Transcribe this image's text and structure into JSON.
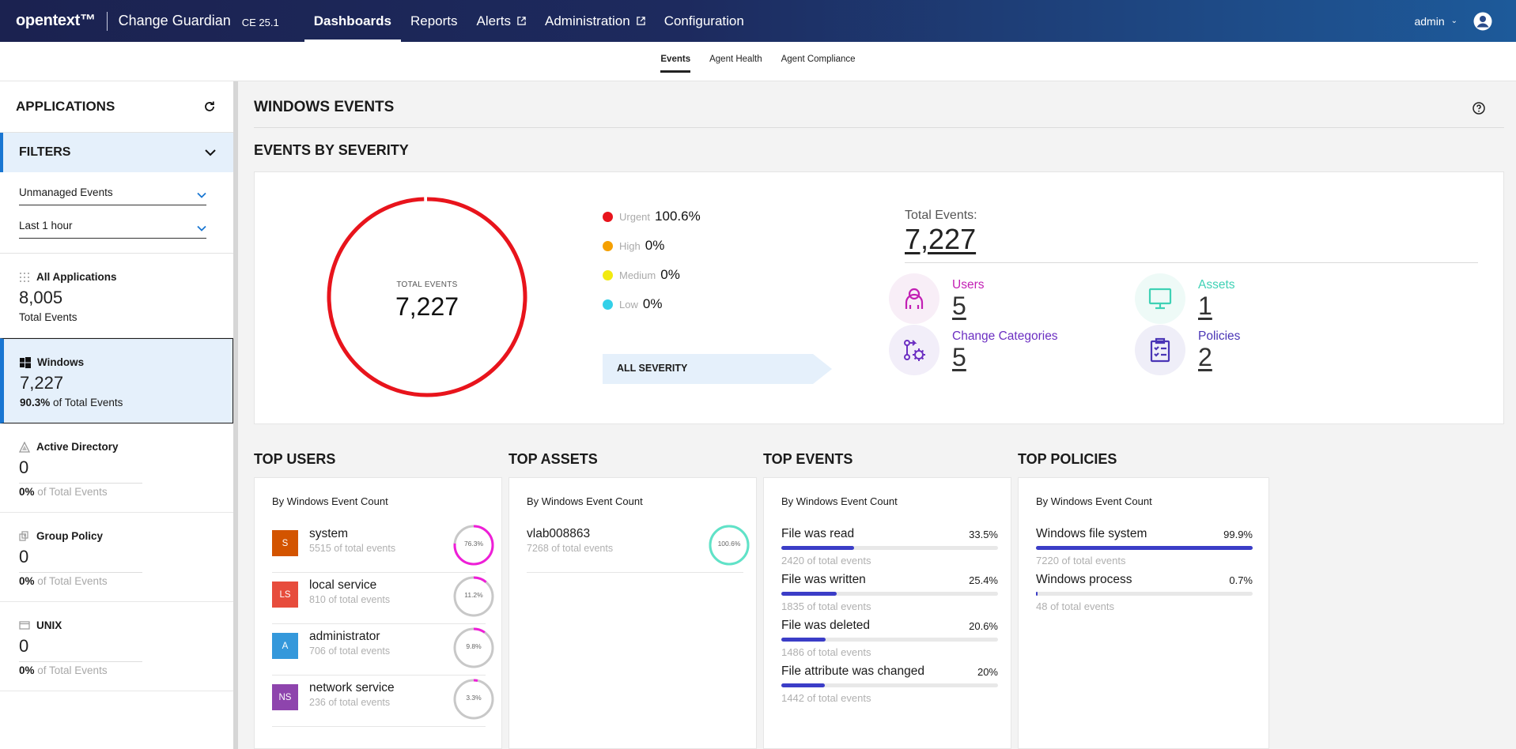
{
  "topbar": {
    "brand": "opentext™",
    "product": "Change Guardian",
    "version": "CE 25.1",
    "nav": [
      {
        "label": "Dashboards",
        "active": true,
        "external": false
      },
      {
        "label": "Reports",
        "active": false,
        "external": false
      },
      {
        "label": "Alerts",
        "active": false,
        "external": true
      },
      {
        "label": "Administration",
        "active": false,
        "external": true
      },
      {
        "label": "Configuration",
        "active": false,
        "external": false
      }
    ],
    "user": "admin",
    "icons": {
      "external": "external-link-icon",
      "caret": "chevron-down-icon",
      "avatar": "user-avatar-icon"
    }
  },
  "subtabs": [
    {
      "label": "Events",
      "active": true
    },
    {
      "label": "Agent Health",
      "active": false
    },
    {
      "label": "Agent Compliance",
      "active": false
    }
  ],
  "sidebar": {
    "title": "APPLICATIONS",
    "filters_title": "FILTERS",
    "filter_event_type": "Unmanaged Events",
    "filter_time": "Last 1 hour",
    "items": [
      {
        "name": "All Applications",
        "count": "8,005",
        "sub_pct": "",
        "sub_text": "Total Events",
        "icon": "grid-dots-icon",
        "selected": false
      },
      {
        "name": "Windows",
        "count": "7,227",
        "sub_pct": "90.3%",
        "sub_text": " of Total Events",
        "icon": "windows-logo-icon",
        "selected": true
      },
      {
        "name": "Active Directory",
        "count": "0",
        "sub_pct": "0%",
        "sub_text": " of Total Events",
        "icon": "active-directory-icon",
        "selected": false
      },
      {
        "name": "Group Policy",
        "count": "0",
        "sub_pct": "0%",
        "sub_text": " of Total Events",
        "icon": "group-policy-icon",
        "selected": false
      },
      {
        "name": "UNIX",
        "count": "0",
        "sub_pct": "0%",
        "sub_text": " of Total Events",
        "icon": "unix-terminal-icon",
        "selected": false
      }
    ]
  },
  "main": {
    "title": "WINDOWS EVENTS",
    "severity_title": "EVENTS BY SEVERITY",
    "donut_label": "TOTAL EVENTS",
    "donut_value": "7,227",
    "donut_color": "#e8141c",
    "legend": [
      {
        "name": "Urgent",
        "pct": "100.6%",
        "color": "#e8141c"
      },
      {
        "name": "High",
        "pct": "0%",
        "color": "#f5a000"
      },
      {
        "name": "Medium",
        "pct": "0%",
        "color": "#f2ea10"
      },
      {
        "name": "Low",
        "pct": "0%",
        "color": "#33d0e8"
      }
    ],
    "all_severity": "ALL SEVERITY",
    "total_label": "Total Events:",
    "total_value": "7,227",
    "stats": [
      {
        "name": "Users",
        "value": "5",
        "color": "#c21fb4",
        "icon": "users-icon"
      },
      {
        "name": "Assets",
        "value": "1",
        "color": "#3fd1b5",
        "icon": "monitor-icon"
      },
      {
        "name": "Change Categories",
        "value": "5",
        "color": "#6c2fc2",
        "icon": "change-categories-icon"
      },
      {
        "name": "Policies",
        "value": "2",
        "color": "#4a35b6",
        "icon": "policy-clipboard-icon"
      }
    ],
    "help_icon": "help-circle-icon"
  },
  "top_users": {
    "title": "TOP USERS",
    "subtitle": "By Windows Event Count",
    "rows": [
      {
        "initials": "S",
        "name": "system",
        "sub": "5515 of total events",
        "pct": "76.3%",
        "fraction": 0.763,
        "badge": "#d35400",
        "ring": "#ef1ed8"
      },
      {
        "initials": "LS",
        "name": "local service",
        "sub": "810 of total events",
        "pct": "11.2%",
        "fraction": 0.112,
        "badge": "#e74c3c",
        "ring": "#ef1ed8"
      },
      {
        "initials": "A",
        "name": "administrator",
        "sub": "706 of total events",
        "pct": "9.8%",
        "fraction": 0.098,
        "badge": "#3498db",
        "ring": "#ef1ed8"
      },
      {
        "initials": "NS",
        "name": "network service",
        "sub": "236 of total events",
        "pct": "3.3%",
        "fraction": 0.033,
        "badge": "#8e44ad",
        "ring": "#ef1ed8"
      }
    ]
  },
  "top_assets": {
    "title": "TOP ASSETS",
    "subtitle": "By Windows Event Count",
    "rows": [
      {
        "name": "vlab008863",
        "sub": "7268 of total events",
        "pct": "100.6%",
        "fraction": 1.0,
        "ring": "#5fe3c8"
      }
    ]
  },
  "top_events": {
    "title": "TOP EVENTS",
    "subtitle": "By Windows Event Count",
    "rows": [
      {
        "name": "File was read",
        "pct": "33.5%",
        "fraction": 0.335,
        "sub": "2420 of total events"
      },
      {
        "name": "File was written",
        "pct": "25.4%",
        "fraction": 0.254,
        "sub": "1835 of total events"
      },
      {
        "name": "File was deleted",
        "pct": "20.6%",
        "fraction": 0.206,
        "sub": "1486 of total events"
      },
      {
        "name": "File attribute was changed",
        "pct": "20%",
        "fraction": 0.2,
        "sub": "1442 of total events"
      }
    ]
  },
  "top_policies": {
    "title": "TOP POLICIES",
    "subtitle": "By Windows Event Count",
    "rows": [
      {
        "name": "Windows file system",
        "pct": "99.9%",
        "fraction": 0.999,
        "sub": "7220 of total events"
      },
      {
        "name": "Windows process",
        "pct": "0.7%",
        "fraction": 0.007,
        "sub": "48 of total events"
      }
    ]
  }
}
